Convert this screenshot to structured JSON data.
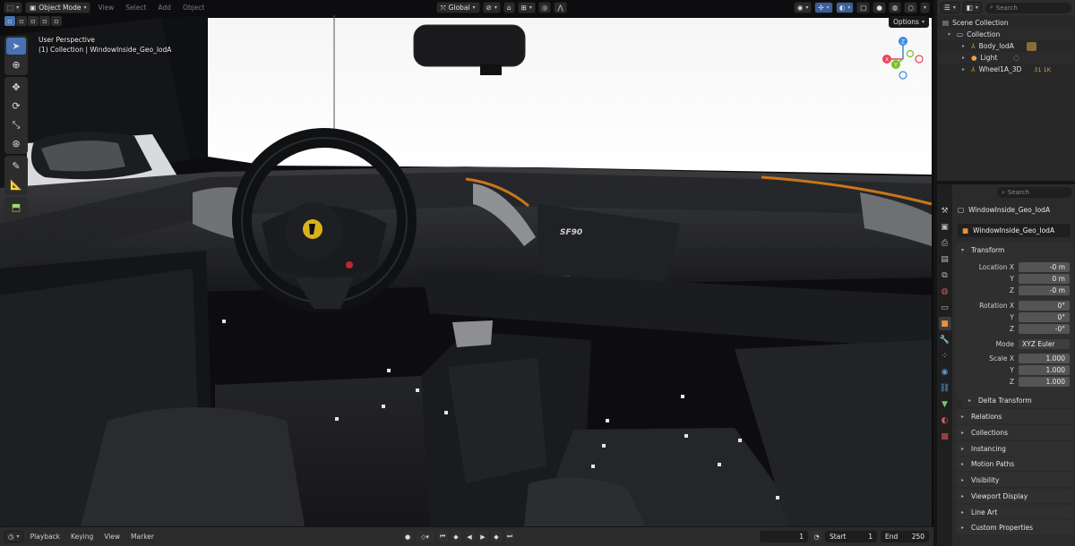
{
  "header": {
    "mode": "Object Mode",
    "menus": [
      "View",
      "Select",
      "Add",
      "Object"
    ],
    "transform_orientation": "Global",
    "options_label": "Options"
  },
  "viewport": {
    "perspective_label": "User Perspective",
    "collection_label": "(1) Collection | WindowInside_Geo_lodA"
  },
  "gizmo": {
    "x_label": "X",
    "y_label": "Y",
    "z_label": "Z"
  },
  "outliner": {
    "search_placeholder": "Search",
    "rows": [
      {
        "label": "Scene Collection"
      },
      {
        "label": "Collection"
      },
      {
        "label": "Body_lodA"
      },
      {
        "label": "Light"
      },
      {
        "label": "Wheel1A_3D",
        "badges": "31 1K"
      }
    ]
  },
  "properties": {
    "search_placeholder": "Search",
    "context_object": "WindowInside_Geo_lodA",
    "object_name": "WindowInside_Geo_lodA",
    "transform": {
      "title": "Transform",
      "location_label": "Location X",
      "rotation_label": "Rotation X",
      "scale_label": "Scale X",
      "y_label": "Y",
      "z_label": "Z",
      "location": [
        "-0 m",
        "0 m",
        "-0 m"
      ],
      "rotation": [
        "0°",
        "0°",
        "-0°"
      ],
      "mode_label": "Mode",
      "mode_value": "XYZ Euler",
      "scale": [
        "1.000",
        "1.000",
        "1.000"
      ],
      "delta_label": "Delta Transform"
    },
    "panels": [
      "Relations",
      "Collections",
      "Instancing",
      "Motion Paths",
      "Visibility",
      "Viewport Display",
      "Line Art",
      "Custom Properties"
    ]
  },
  "timeline": {
    "menus": [
      "Playback",
      "Keying",
      "View",
      "Marker"
    ],
    "current_frame": "1",
    "start_label": "Start",
    "start_value": "1",
    "end_label": "End",
    "end_value": "250"
  },
  "colors": {
    "accent": "#4772b3",
    "axis_x": "#e8445a",
    "axis_y": "#7bbf27",
    "axis_z": "#3a8be0"
  }
}
